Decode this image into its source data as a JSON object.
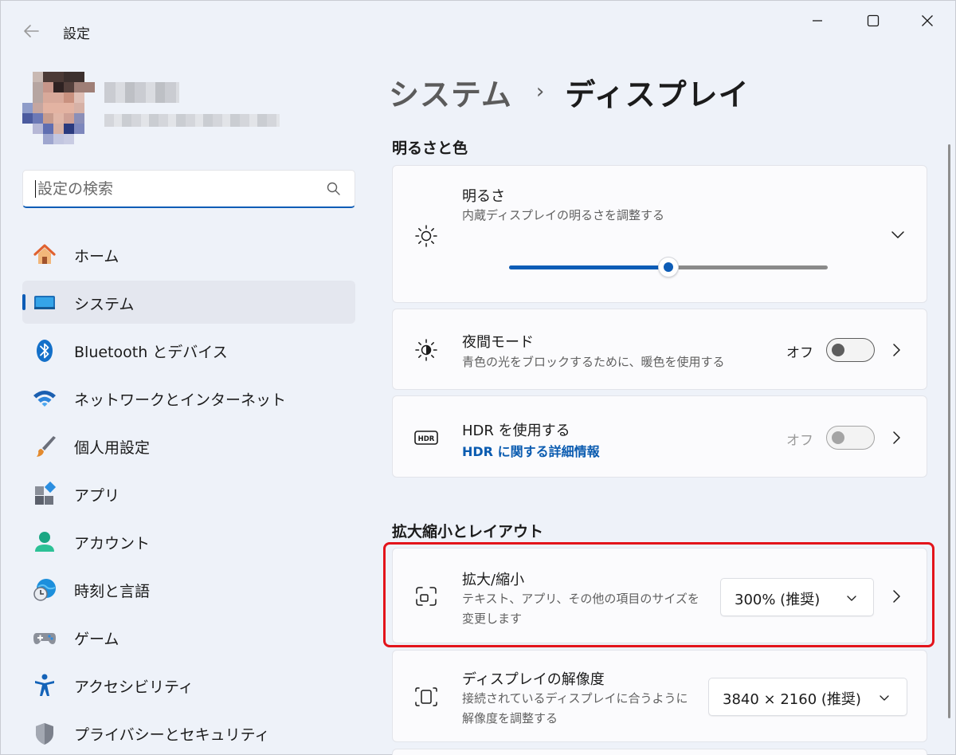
{
  "window": {
    "title": "設定"
  },
  "search": {
    "placeholder": "設定の検索"
  },
  "nav": {
    "items": [
      {
        "label": "ホーム",
        "icon": "home-icon"
      },
      {
        "label": "システム",
        "icon": "system-icon",
        "active": true
      },
      {
        "label": "Bluetooth とデバイス",
        "icon": "bluetooth-icon"
      },
      {
        "label": "ネットワークとインターネット",
        "icon": "wifi-icon"
      },
      {
        "label": "個人用設定",
        "icon": "brush-icon"
      },
      {
        "label": "アプリ",
        "icon": "apps-icon"
      },
      {
        "label": "アカウント",
        "icon": "account-icon"
      },
      {
        "label": "時刻と言語",
        "icon": "globe-clock-icon"
      },
      {
        "label": "ゲーム",
        "icon": "gamepad-icon"
      },
      {
        "label": "アクセシビリティ",
        "icon": "accessibility-icon"
      },
      {
        "label": "プライバシーとセキュリティ",
        "icon": "shield-icon"
      }
    ]
  },
  "breadcrumb": {
    "parent": "システム",
    "separator": "›",
    "current": "ディスプレイ"
  },
  "sections": {
    "brightness_color": "明るさと色",
    "scale_layout": "拡大縮小とレイアウト"
  },
  "brightness": {
    "title": "明るさ",
    "description": "内蔵ディスプレイの明るさを調整する",
    "level_percent": 50
  },
  "night_mode": {
    "title": "夜間モード",
    "description": "青色の光をブロックするために、暖色を使用する",
    "state": "オフ"
  },
  "hdr": {
    "title": "HDR を使用する",
    "link": "HDR に関する詳細情報",
    "state": "オフ",
    "icon_text": "HDR"
  },
  "scale": {
    "title": "拡大/縮小",
    "description_line1": "テキスト、アプリ、その他の項目のサイズを",
    "description_line2": "変更します",
    "value": "300% (推奨)"
  },
  "resolution": {
    "title": "ディスプレイの解像度",
    "description_line1": "接続されているディスプレイに合うように",
    "description_line2": "解像度を調整する",
    "value": "3840 × 2160 (推奨)"
  },
  "colors": {
    "accent": "#0d5cb6",
    "highlight": "#e3141b",
    "link": "#0a5bb0"
  }
}
